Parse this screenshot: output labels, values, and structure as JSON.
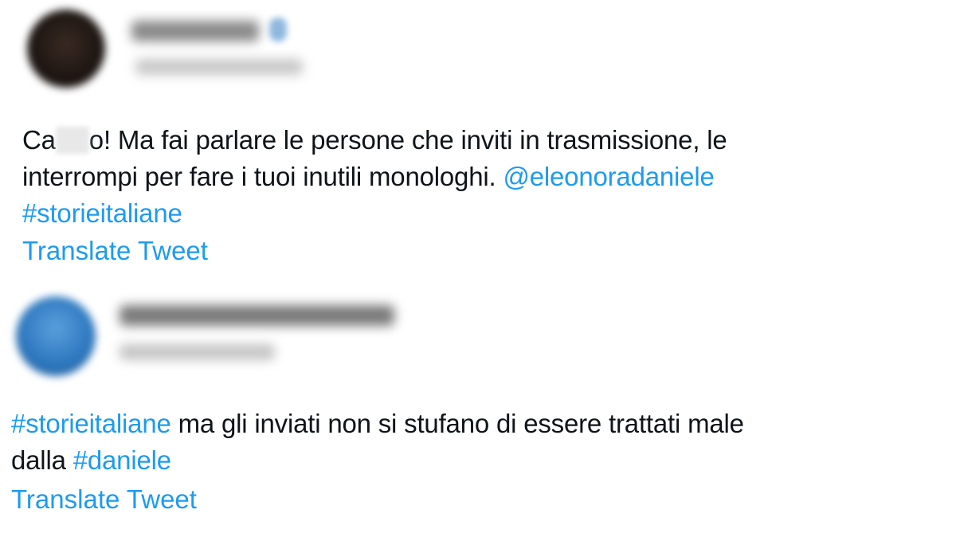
{
  "tweets": [
    {
      "name_hidden": true,
      "handle_hidden": true,
      "text_prefix": "Ca",
      "text_after_mask": "o! Ma fai parlare le persone che inviti in trasmissione, le",
      "line2_text": "interrompi per fare i tuoi inutili monologhi. ",
      "mention": "@eleonoradaniele",
      "hashtag": "#storieitaliane",
      "translate_label": "Translate Tweet"
    },
    {
      "name_hidden": true,
      "handle_hidden": true,
      "hashtag": "#storieitaliane",
      "line1_text": " ma gli inviati non si stufano di essere trattati male",
      "line2_text": "dalla ",
      "hashtag2": "#daniele",
      "translate_label": "Translate Tweet"
    }
  ],
  "colors": {
    "link": "#1d9bf0",
    "text": "#0f1419",
    "background": "#ffffff"
  }
}
